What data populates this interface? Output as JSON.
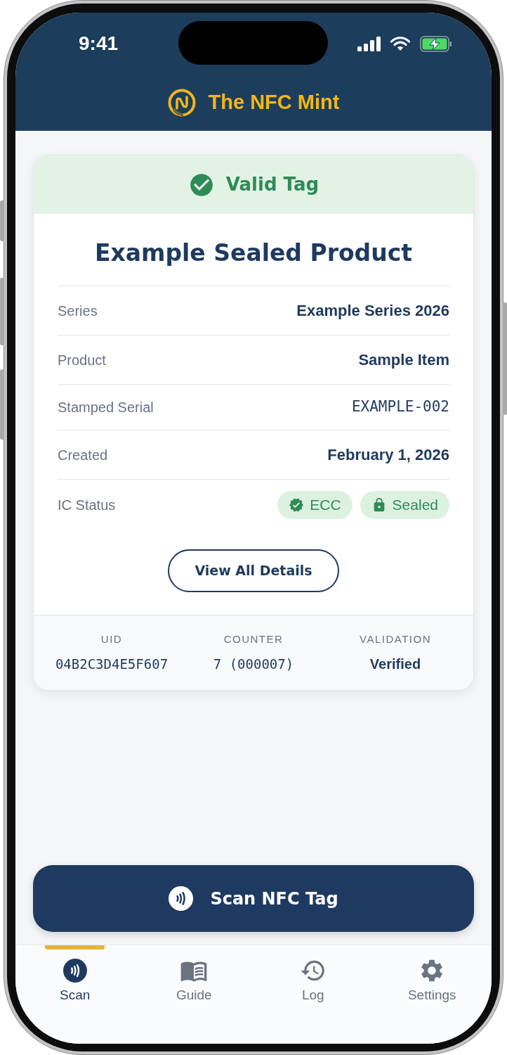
{
  "status_bar": {
    "time": "9:41"
  },
  "header": {
    "title": "The NFC Mint"
  },
  "result": {
    "kind": "valid",
    "status": "Valid Tag",
    "title": "Example Sealed Product",
    "fields": [
      {
        "label": "Series",
        "value": "Example Series 2026",
        "kind": "text"
      },
      {
        "label": "Product",
        "value": "Sample Item",
        "kind": "text"
      },
      {
        "label": "Stamped Serial",
        "value": "EXAMPLE-002",
        "kind": "mono"
      },
      {
        "label": "Created",
        "value": "February 1, 2026",
        "kind": "text"
      },
      {
        "label": "IC Status",
        "kind": "badges",
        "badges": [
          {
            "label": "ECC",
            "kind": "verified"
          },
          {
            "label": "Sealed",
            "kind": "locked"
          }
        ]
      }
    ],
    "details_button": "View All Details",
    "summary": [
      {
        "label": "UID",
        "value": "04B2C3D4E5F607",
        "kind": "mono"
      },
      {
        "label": "COUNTER",
        "value": "7 (000007)",
        "kind": "mono"
      },
      {
        "label": "VALIDATION",
        "value": "Verified",
        "kind": "text"
      }
    ]
  },
  "scan_button": "Scan NFC Tag",
  "tabs": [
    {
      "label": "Scan",
      "kind": "scan",
      "selected": true
    },
    {
      "label": "Guide",
      "kind": "guide",
      "selected": false
    },
    {
      "label": "Log",
      "kind": "log",
      "selected": false
    },
    {
      "label": "Settings",
      "kind": "settings",
      "selected": false
    }
  ]
}
